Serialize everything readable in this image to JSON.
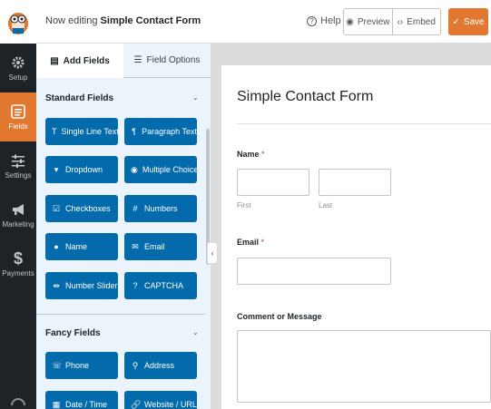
{
  "topbar": {
    "editing_prefix": "Now editing",
    "form_name": "Simple Contact Form",
    "help_label": "Help",
    "preview_label": "Preview",
    "embed_label": "Embed",
    "save_label": "Save"
  },
  "leftnav": {
    "items": [
      {
        "label": "Setup",
        "icon": "gear-icon"
      },
      {
        "label": "Fields",
        "icon": "fields-list-icon",
        "active": true
      },
      {
        "label": "Settings",
        "icon": "sliders-icon"
      },
      {
        "label": "Marketing",
        "icon": "megaphone-icon"
      },
      {
        "label": "Payments",
        "icon": "dollar-icon"
      }
    ]
  },
  "panel": {
    "tabs": {
      "add_fields": "Add Fields",
      "field_options": "Field Options"
    },
    "standard_title": "Standard Fields",
    "standard_fields": [
      {
        "label": "Single Line Text",
        "icon": "T"
      },
      {
        "label": "Paragraph Text",
        "icon": "¶"
      },
      {
        "label": "Dropdown",
        "icon": "▾"
      },
      {
        "label": "Multiple Choice",
        "icon": "◉"
      },
      {
        "label": "Checkboxes",
        "icon": "☑"
      },
      {
        "label": "Numbers",
        "icon": "#"
      },
      {
        "label": "Name",
        "icon": "●"
      },
      {
        "label": "Email",
        "icon": "✉"
      },
      {
        "label": "Number Slider",
        "icon": "⇹"
      },
      {
        "label": "CAPTCHA",
        "icon": "?"
      }
    ],
    "fancy_title": "Fancy Fields",
    "fancy_fields": [
      {
        "label": "Phone",
        "icon": "☏"
      },
      {
        "label": "Address",
        "icon": "⚲"
      },
      {
        "label": "Date / Time",
        "icon": "▦"
      },
      {
        "label": "Website / URL",
        "icon": "🔗"
      }
    ]
  },
  "form": {
    "title": "Simple Contact Form",
    "name_label": "Name",
    "required_mark": "*",
    "first_label": "First",
    "last_label": "Last",
    "email_label": "Email",
    "comment_label": "Comment or Message"
  },
  "colors": {
    "accent": "#e27730",
    "field_button": "#036aab",
    "nav_bg": "#1d2327"
  }
}
